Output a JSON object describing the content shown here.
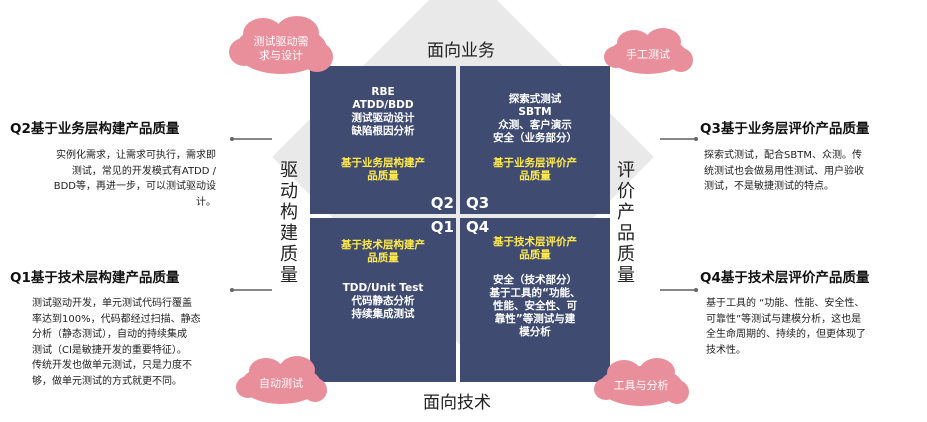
{
  "axes": {
    "top": "面向业务",
    "bottom": "面向技术",
    "left": [
      "驱",
      "动",
      "构",
      "建",
      "质",
      "量"
    ],
    "right": [
      "评",
      "价",
      "产",
      "品",
      "质",
      "量"
    ]
  },
  "quadrants": {
    "q2": {
      "label": "Q2",
      "practices": [
        "RBE",
        "ATDD/BDD",
        "测试驱动设计",
        "缺陷根因分析"
      ],
      "goal": [
        "基于业务层构建产",
        "品质量"
      ]
    },
    "q3": {
      "label": "Q3",
      "practices": [
        "探索式测试",
        "SBTM",
        "众测、客户演示",
        "安全（业务部分）"
      ],
      "goal": [
        "基于业务层评价产",
        "品质量"
      ]
    },
    "q1": {
      "label": "Q1",
      "goal": [
        "基于技术层构建产",
        "品质量"
      ],
      "practices": [
        "TDD/Unit Test",
        "代码静态分析",
        "持续集成测试"
      ]
    },
    "q4": {
      "label": "Q4",
      "goal": [
        "基于技术层评价产",
        "品质量"
      ],
      "practices": [
        "安全（技术部分）",
        "基于工具的“功能、",
        "性能、安全性、可",
        "靠性”等测试与建",
        "模分析"
      ]
    }
  },
  "clouds": {
    "top_left": [
      "测试驱动需",
      "求与设计"
    ],
    "top_right": "手工测试",
    "bottom_left": "自动测试",
    "bottom_right": "工具与分析"
  },
  "left_panel": {
    "q2": {
      "title": "Q2基于业务层构建产品质量",
      "lines": [
        "实例化需求，让需求可执行，需求即",
        "测试，常见的开发模式有ATDD /",
        "BDD等，再进一步，可以测试驱动设",
        "计。"
      ]
    },
    "q1": {
      "title": "Q1基于技术层构建产品质量",
      "lines": [
        "测试驱动开发，单元测试代码行覆盖",
        "率达到100%，代码都经过扫描、静态",
        "分析（静态测试），自动的持续集成",
        "测试（CI是敏捷开发的重要特征）。",
        "传统开发也做单元测试，只是力度不",
        "够，做单元测试的方式就更不同。"
      ]
    }
  },
  "right_panel": {
    "q3": {
      "title": "Q3基于业务层评价产品质量",
      "lines": [
        "探索式测试，配合SBTM、众测。传",
        "统测试也会做易用性测试、用户验收",
        "测试，不是敏捷测试的特点。"
      ]
    },
    "q4": {
      "title": "Q4基于技术层评价产品质量",
      "lines": [
        "基于工具的 “功能、性能、安全性、",
        "可靠性”等测试与建模分析，这也是",
        "全生命周期的、持续的，但更体现了",
        "技术性。"
      ]
    }
  },
  "colors": {
    "quadrant": "#3f4b71",
    "highlight": "#ffe94d",
    "cloud": "#e98f9c",
    "diamond": "#e9e9ea"
  }
}
